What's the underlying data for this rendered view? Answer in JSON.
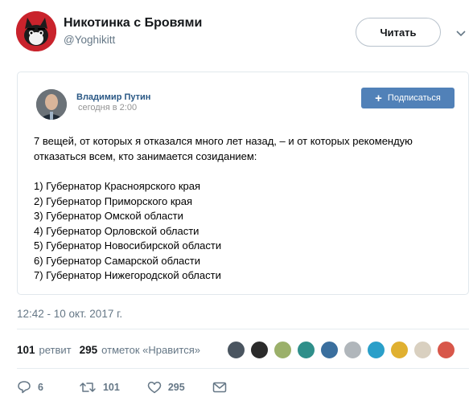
{
  "author": {
    "name": "Никотинка с Бровями",
    "handle": "@Yoghikitt",
    "follow_label": "Читать"
  },
  "embed": {
    "poster_name": "Владимир Путин",
    "poster_time": "сегодня в 2:00",
    "subscribe_label": "Подписаться",
    "intro": "7 вещей, от которых я отказался много лет назад, – и от которых рекомендую отказаться всем, кто занимается созиданием:",
    "items": [
      "1) Губернатор Красноярского края",
      "2) Губернатор Приморского края",
      "3) Губернатор Омской области",
      "4) Губернатор Орловской области",
      "5) Губернатор Новосибирской области",
      "6) Губернатор Самарской области",
      "7) Губернатор Нижегородской области"
    ]
  },
  "timestamp": "12:42 - 10 окт. 2017 г.",
  "stats": {
    "retweets_count": "101",
    "retweets_label": "ретвит",
    "likes_count": "295",
    "likes_label": "отметок «Нравится»"
  },
  "actions": {
    "reply_count": "6",
    "retweet_count": "101",
    "like_count": "295"
  },
  "colors": {
    "accent": "#1da1f2",
    "vk_button": "#5181b8",
    "vk_link": "#2a5885",
    "muted": "#657786"
  },
  "icons": [
    "caret-down-icon",
    "plus-icon",
    "reply-icon",
    "retweet-icon",
    "heart-icon",
    "message-icon"
  ],
  "likers": [
    "#4a5560",
    "#2b2b2b",
    "#9bb06a",
    "#2f8f8a",
    "#3a6f9e",
    "#b0b6bb",
    "#2a9fc9",
    "#e0b030",
    "#d9d0c0",
    "#d8574a"
  ]
}
